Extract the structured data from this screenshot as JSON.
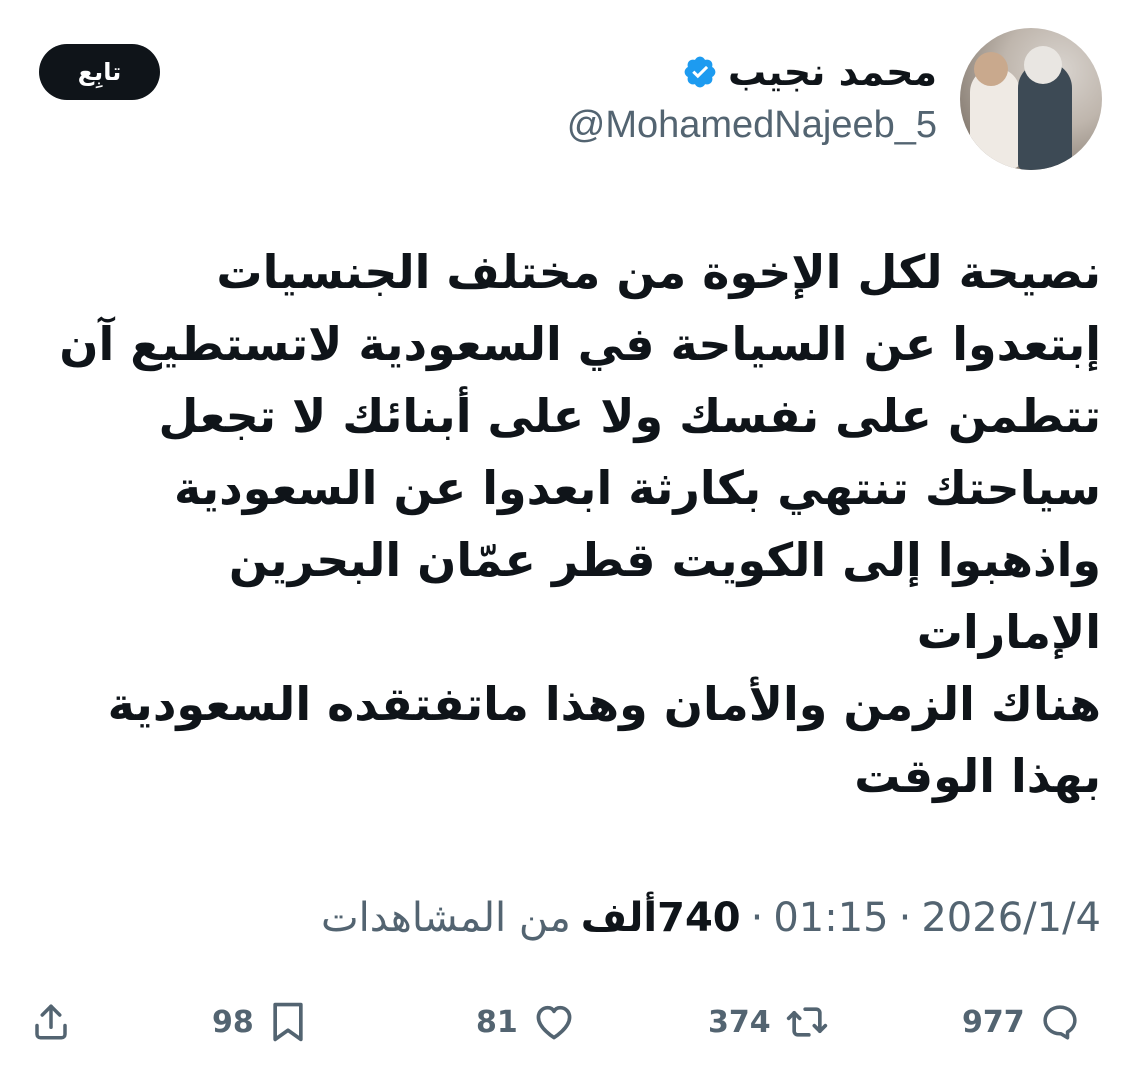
{
  "author": {
    "name": "محمد نجيب",
    "handle": "@MohamedNajeeb_5",
    "verified": true,
    "verified_color": "#1d9bf0"
  },
  "follow_button": {
    "label": "تابِع"
  },
  "tweet": {
    "lines": [
      "نصيحة لكل الإخوة من مختلف الجنسيات",
      "إبتعدوا عن السياحة في السعودية لاتستطيع آن",
      "تتطمن على نفسك ولا على أبنائك لا تجعل",
      "سياحتك تنتهي بكارثة ابعدوا عن السعودية",
      "واذهبوا إلى الكويت قطر عمّان البحرين",
      "الإمارات",
      "هناك الزمن والأمان وهذا ماتفتقده السعودية",
      "بهذا الوقت"
    ]
  },
  "meta": {
    "date": "2026/1/4",
    "time": "01:15",
    "separator": "·",
    "views_count": "740",
    "views_unit": "ألف",
    "views_label": "من المشاهدات"
  },
  "actions": {
    "replies": "977",
    "reposts": "374",
    "likes": "81",
    "bookmarks": "98",
    "icons": [
      "reply-icon",
      "repost-icon",
      "like-icon",
      "bookmark-icon",
      "share-icon"
    ]
  },
  "colors": {
    "text_primary": "#0f1419",
    "text_secondary": "#536471",
    "follow_bg": "#0f1419"
  }
}
